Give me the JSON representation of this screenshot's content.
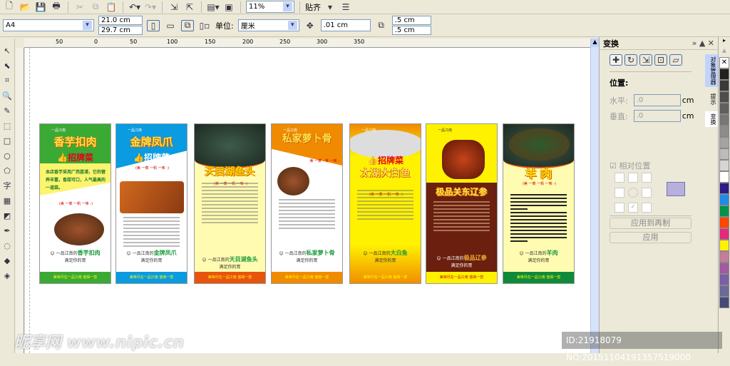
{
  "toolbar": {
    "zoom": "11%",
    "snap_label": "贴齐"
  },
  "property_bar": {
    "page_size": "A4",
    "width": "21.0 cm",
    "height": "29.7 cm",
    "units_label": "单位:",
    "units": "厘米",
    "nudge": ".01 cm",
    "dup_x": ".5 cm",
    "dup_y": ".5 cm"
  },
  "ruler": {
    "ticks": [
      "50",
      "0",
      "50",
      "100",
      "150",
      "200",
      "250",
      "300",
      "350"
    ]
  },
  "docker": {
    "title": "变换",
    "position_label": "位置:",
    "h_label": "水平:",
    "h_value": ".0",
    "v_label": "垂直:",
    "v_value": ".0",
    "unit": "cm",
    "relative_label": "相对位置",
    "apply_dup": "应用到再制",
    "apply": "应用",
    "tabs": [
      "对象管理器",
      "提示",
      "变换"
    ]
  },
  "palette": [
    "#ffffff",
    "#231f20",
    "#3a3a3a",
    "#4d4d4d",
    "#606060",
    "#777777",
    "#8c8c8c",
    "#a3a3a3",
    "#bcbcbc",
    "#d5d5d5",
    "#ffffff",
    "#2e1a87",
    "#1e8ce8",
    "#00934a",
    "#ff4500",
    "#e8277a",
    "#fff200",
    "#c47d9a",
    "#a35aa0",
    "#7b5ea7",
    "#6a6a9a",
    "#464a78"
  ],
  "posters": [
    {
      "title": "香芋扣肉",
      "sub": "招牌菜",
      "logo": "一品江南",
      "intro": "本店香芋采用广西荔浦，它的营养丰富，香甜可口，人气最高的一道菜。",
      "tag": "(美 一菜 一帆 一味 -)",
      "slogan1": "一品江南的",
      "dish": "香芋扣肉",
      "slogan2": "满足你的胃",
      "foot": "美味尽在一品江南  值得一尝",
      "bg": "#3aaa35",
      "body": "#ffffff"
    },
    {
      "title": "金牌凤爪",
      "sub": "招牌菜",
      "logo": "一品江南",
      "tag": "(美 一菜 一帆 一味 -)",
      "slogan1": "一品江南的",
      "dish": "金牌凤爪",
      "slogan2": "满足你的胃",
      "foot": "美味尽在一品江南  值得一尝",
      "bg": "#0a9be0",
      "body": "#ffffff"
    },
    {
      "title": "天目湖鱼头",
      "tag": "(美 一菜 一帆 一味 -)",
      "slogan1": "一品江南的",
      "dish": "天目湖鱼头",
      "slogan2": "满足你的胃",
      "foot": "美味尽在一品江南  值得一尝",
      "bg": "#e8540e",
      "body": "#fffbb0"
    },
    {
      "title": "私家萝卜骨",
      "logo": "一品江南",
      "tag": "美 一菜 - 味 一味 -",
      "slogan1": "一品江南的",
      "dish": "私家萝卜骨",
      "slogan2": "满足你的胃",
      "foot": "美味尽在一品江南  值得一尝",
      "bg": "#f08a00",
      "body": "#ffffff"
    },
    {
      "title": "太湖大白鱼",
      "sub": "招牌菜",
      "logo": "一品江南",
      "tag": "(美 一菜 一帆 一味 -)",
      "slogan1": "一品江南的",
      "dish": "大白鱼",
      "slogan2": "满足你的胃",
      "foot": "美味尽在一品江南  值得一尝",
      "bg": "#f08a00",
      "body": "#fff200"
    },
    {
      "title": "极品关东辽参",
      "logo": "一品江南",
      "slogan1": "一品江南的",
      "dish": "极品辽参",
      "slogan2": "满足你的胃",
      "foot": "美味尽在一品江南  值得一尝",
      "bg": "#fff200",
      "body": "#6b1f0e"
    },
    {
      "title": "羊 肉",
      "tag": "(美 一菜 一帆 一味 -)",
      "slogan1": "一品江南的",
      "dish": "羊肉",
      "slogan2": "满足你的胃",
      "foot": "美味尽在一品江南  值得一尝",
      "bg": "#0f8a3a",
      "body": "#fffbb0"
    }
  ],
  "watermark": {
    "site": "昵享网 www.nipic.cn",
    "id": "ID:21918079 NO:20151104191357519000"
  }
}
